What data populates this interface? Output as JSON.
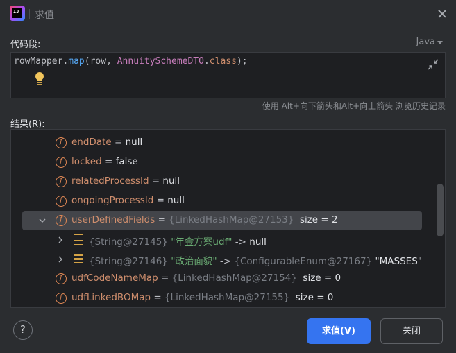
{
  "window": {
    "title": "求值",
    "close_label": "close"
  },
  "code_section": {
    "label": "代码段:",
    "language": "Java",
    "code": {
      "receiver": "rowMapper",
      "dot": ".",
      "method": "map",
      "open": "(",
      "arg1": "row",
      "comma": ", ",
      "type": "AnnuitySchemeDTO",
      "dot2": ".",
      "keyword": "class",
      "close": ");"
    },
    "history_hint": "使用 Alt+向下箭头和Alt+向上箭头 浏览历史记录"
  },
  "result_section": {
    "label_prefix": "结果(",
    "label_mnemonic": "R",
    "label_suffix": "):",
    "rows": [
      {
        "icon": "f",
        "name": "endDate",
        "eq": " = ",
        "value": "null"
      },
      {
        "icon": "f",
        "name": "locked",
        "eq": " = ",
        "value": "false"
      },
      {
        "icon": "f",
        "name": "relatedProcessId",
        "eq": " = ",
        "value": "null"
      },
      {
        "icon": "f",
        "name": "ongoingProcessId",
        "eq": " = ",
        "value": "null"
      },
      {
        "icon": "f",
        "name": "userDefinedFields",
        "eq": " = ",
        "ref": "{LinkedHashMap@27153}",
        "value": "  size = 2",
        "expanded": true,
        "selected": true
      },
      {
        "key_ref": "{String@27145}",
        "key_str": " \"年金方案udf\"",
        "arrow": " -> ",
        "value": "null"
      },
      {
        "key_ref": "{String@27146}",
        "key_str": " \"政治面貌\"",
        "arrow": " -> ",
        "val_ref": "{ConfigurableEnum@27167}",
        "value": " \"MASSES\""
      },
      {
        "icon": "f",
        "name": "udfCodeNameMap",
        "eq": " = ",
        "ref": "{LinkedHashMap@27154}",
        "value": "  size = 0"
      },
      {
        "icon": "f",
        "name": "udfLinkedBOMap",
        "eq": " = ",
        "ref": "{LinkedHashMap@27155}",
        "value": "  size = 0"
      }
    ]
  },
  "footer": {
    "help_label": "?",
    "evaluate_label": "求值(V)",
    "close_label": "关闭"
  }
}
